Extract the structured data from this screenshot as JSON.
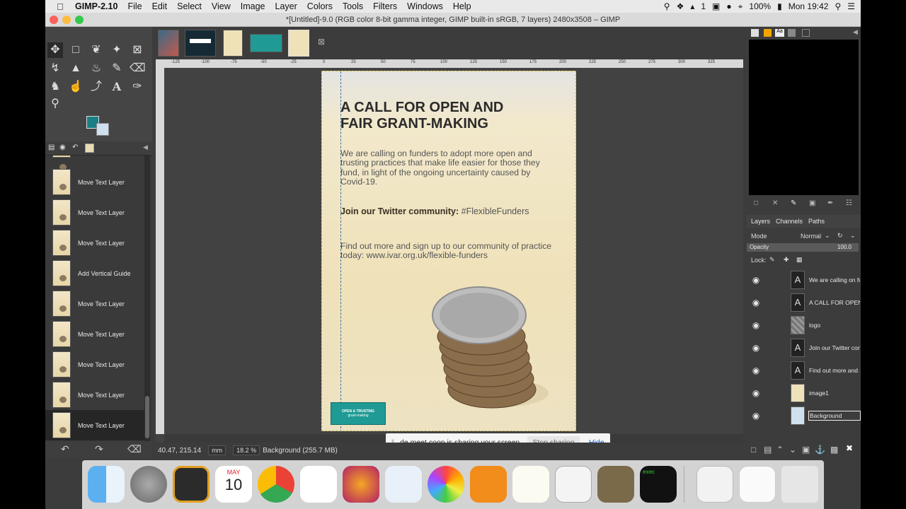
{
  "menubar": {
    "apple": "",
    "app_name": "GIMP-2.10",
    "items": [
      "File",
      "Edit",
      "Select",
      "View",
      "Image",
      "Layer",
      "Colors",
      "Tools",
      "Filters",
      "Windows",
      "Help"
    ],
    "battery": "100%",
    "clock": "Mon 19:42",
    "input_indicator": "1"
  },
  "window": {
    "title": "*[Untitled]-9.0 (RGB color 8-bit gamma integer, GIMP built-in sRGB, 7 layers) 2480x3508 – GIMP"
  },
  "toolbox": {
    "icons": [
      "move-tool",
      "rect-select-tool",
      "lasso-tool",
      "fuzzy-select-tool",
      "crop-tool",
      "warp-transform-tool",
      "flip-tool",
      "bucket-fill-tool",
      "paintbrush-tool",
      "eraser-tool",
      "clone-tool",
      "smudge-tool",
      "path-tool",
      "text-tool",
      "color-picker-tool",
      "zoom-tool"
    ],
    "fg_color": "#1a7f86",
    "bg_color": "#cfe0ee"
  },
  "undo_history": [
    {
      "label": "Move Text Layer",
      "active": false
    },
    {
      "label": "Move Text Layer",
      "active": false
    },
    {
      "label": "Move Text Layer",
      "active": false
    },
    {
      "label": "Add Vertical Guide",
      "active": false
    },
    {
      "label": "Move Text Layer",
      "active": false
    },
    {
      "label": "Move Text Layer",
      "active": false
    },
    {
      "label": "Move Text Layer",
      "active": false
    },
    {
      "label": "Move Text Layer",
      "active": false
    },
    {
      "label": "Move Text Layer",
      "active": true
    }
  ],
  "rulers": {
    "h_ticks": [
      "-125",
      "-100",
      "-75",
      "-50",
      "-25",
      "0",
      "25",
      "50",
      "75",
      "100",
      "125",
      "150",
      "175",
      "200",
      "225",
      "250",
      "275",
      "300",
      "325"
    ]
  },
  "poster": {
    "title_line1": "A CALL FOR OPEN AND",
    "title_line2": "FAIR GRANT-MAKING",
    "para1": "We are calling on funders to adopt more open and trusting practices that make life easier for those they fund, in light of the ongoing uncertainty caused by Covid-19.",
    "twitter_bold": "Join our Twitter community:",
    "twitter_tag": " #FlexibleFunders",
    "para3": "Find out more and sign up to our community of practice today: www.ivar.org.uk/flexible-funders",
    "logo_line1": "OPEN & TRUSTING",
    "logo_line2": "grant-making"
  },
  "share_bar": {
    "message": "de.meet.coop is sharing your screen.",
    "stop": "Stop sharing",
    "hide": "Hide"
  },
  "status": {
    "coords": "40.47, 215.14",
    "unit": "mm",
    "zoom": "18.2 %",
    "layer_info": "Background (255.7 MB)"
  },
  "layers_panel": {
    "tabs": [
      "Layers",
      "Channels",
      "Paths"
    ],
    "mode_label": "Mode",
    "mode_value": "Normal",
    "opacity_label": "Opacity",
    "opacity_value": "100.0",
    "lock_label": "Lock:",
    "layers": [
      {
        "name": "We are calling on fu",
        "type": "text"
      },
      {
        "name": "A CALL FOR OPEN",
        "type": "text"
      },
      {
        "name": "logo",
        "type": "image"
      },
      {
        "name": "Join our Twitter con",
        "type": "text"
      },
      {
        "name": "Find out more and s",
        "type": "text"
      },
      {
        "name": "image1",
        "type": "image"
      },
      {
        "name": "Background",
        "type": "image"
      }
    ]
  },
  "dock": {
    "icons": [
      "finder-icon",
      "launchpad-icon",
      "window-manager-icon",
      "calendar-icon",
      "chrome-icon",
      "reminders-icon",
      "audacity-icon",
      "preview-icon",
      "photos-icon",
      "books-icon",
      "textedit-icon",
      "document-icon",
      "gimp-icon",
      "terminal-icon",
      "document-stack-icon",
      "folder-icon",
      "trash-icon"
    ],
    "calendar_month": "MAY",
    "calendar_day": "10",
    "terminal_text": "exec"
  }
}
